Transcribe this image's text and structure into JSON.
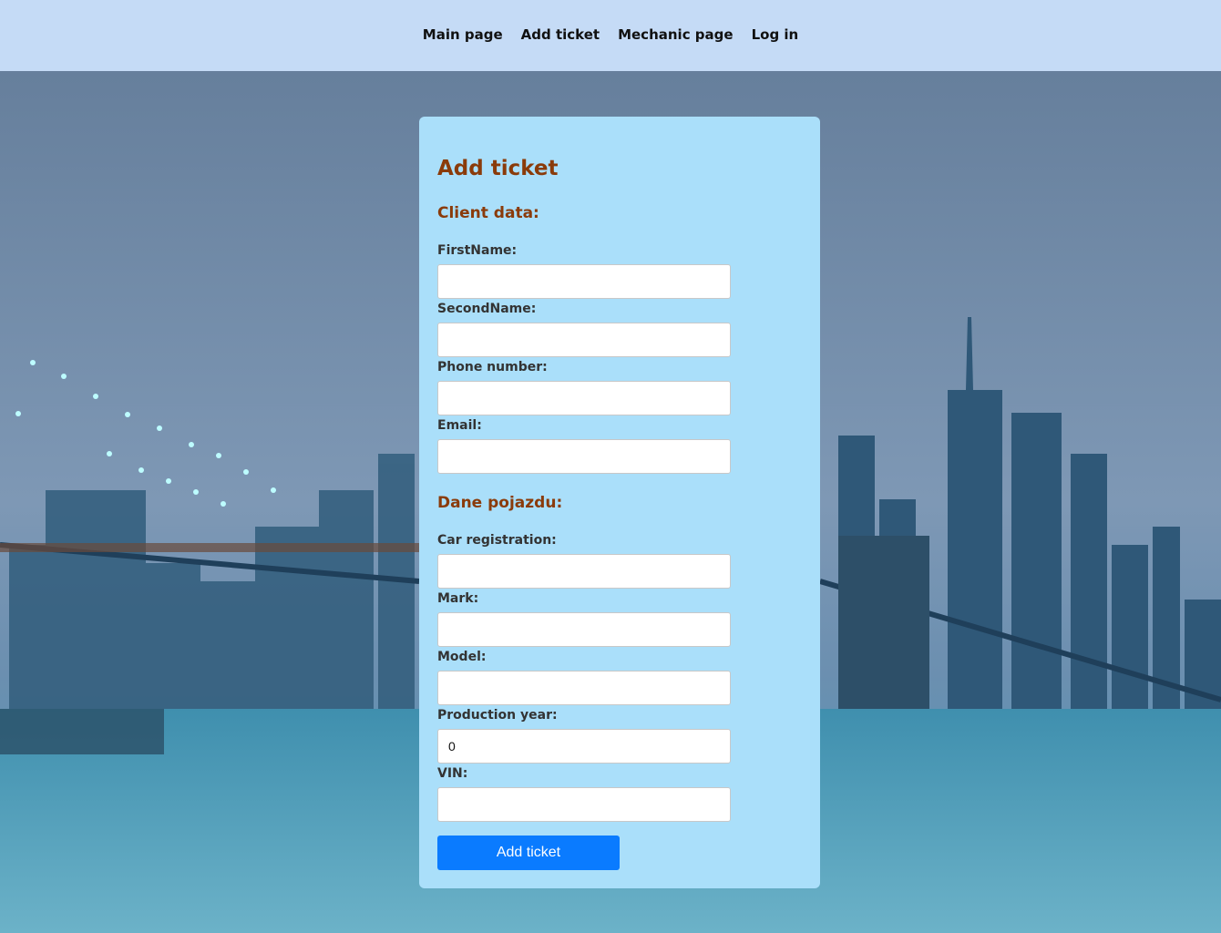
{
  "nav": {
    "items": [
      {
        "label": "Main page"
      },
      {
        "label": "Add ticket"
      },
      {
        "label": "Mechanic page"
      },
      {
        "label": "Log in"
      }
    ]
  },
  "form": {
    "title": "Add ticket",
    "client_section_title": "Client data:",
    "vehicle_section_title": "Dane pojazdu:",
    "fields": {
      "first_name": {
        "label": "FirstName:",
        "value": ""
      },
      "second_name": {
        "label": "SecondName:",
        "value": ""
      },
      "phone": {
        "label": "Phone number:",
        "value": ""
      },
      "email": {
        "label": "Email:",
        "value": ""
      },
      "car_registration": {
        "label": "Car registration:",
        "value": ""
      },
      "mark": {
        "label": "Mark:",
        "value": ""
      },
      "model": {
        "label": "Model:",
        "value": ""
      },
      "production_year": {
        "label": "Production year:",
        "value": "0"
      },
      "vin": {
        "label": "VIN:",
        "value": ""
      }
    },
    "submit_label": "Add ticket"
  },
  "colors": {
    "navbar_bg": "#c5dbf6",
    "card_bg": "#aadffa",
    "heading": "#8a3b0a",
    "button": "#0a7bff"
  }
}
